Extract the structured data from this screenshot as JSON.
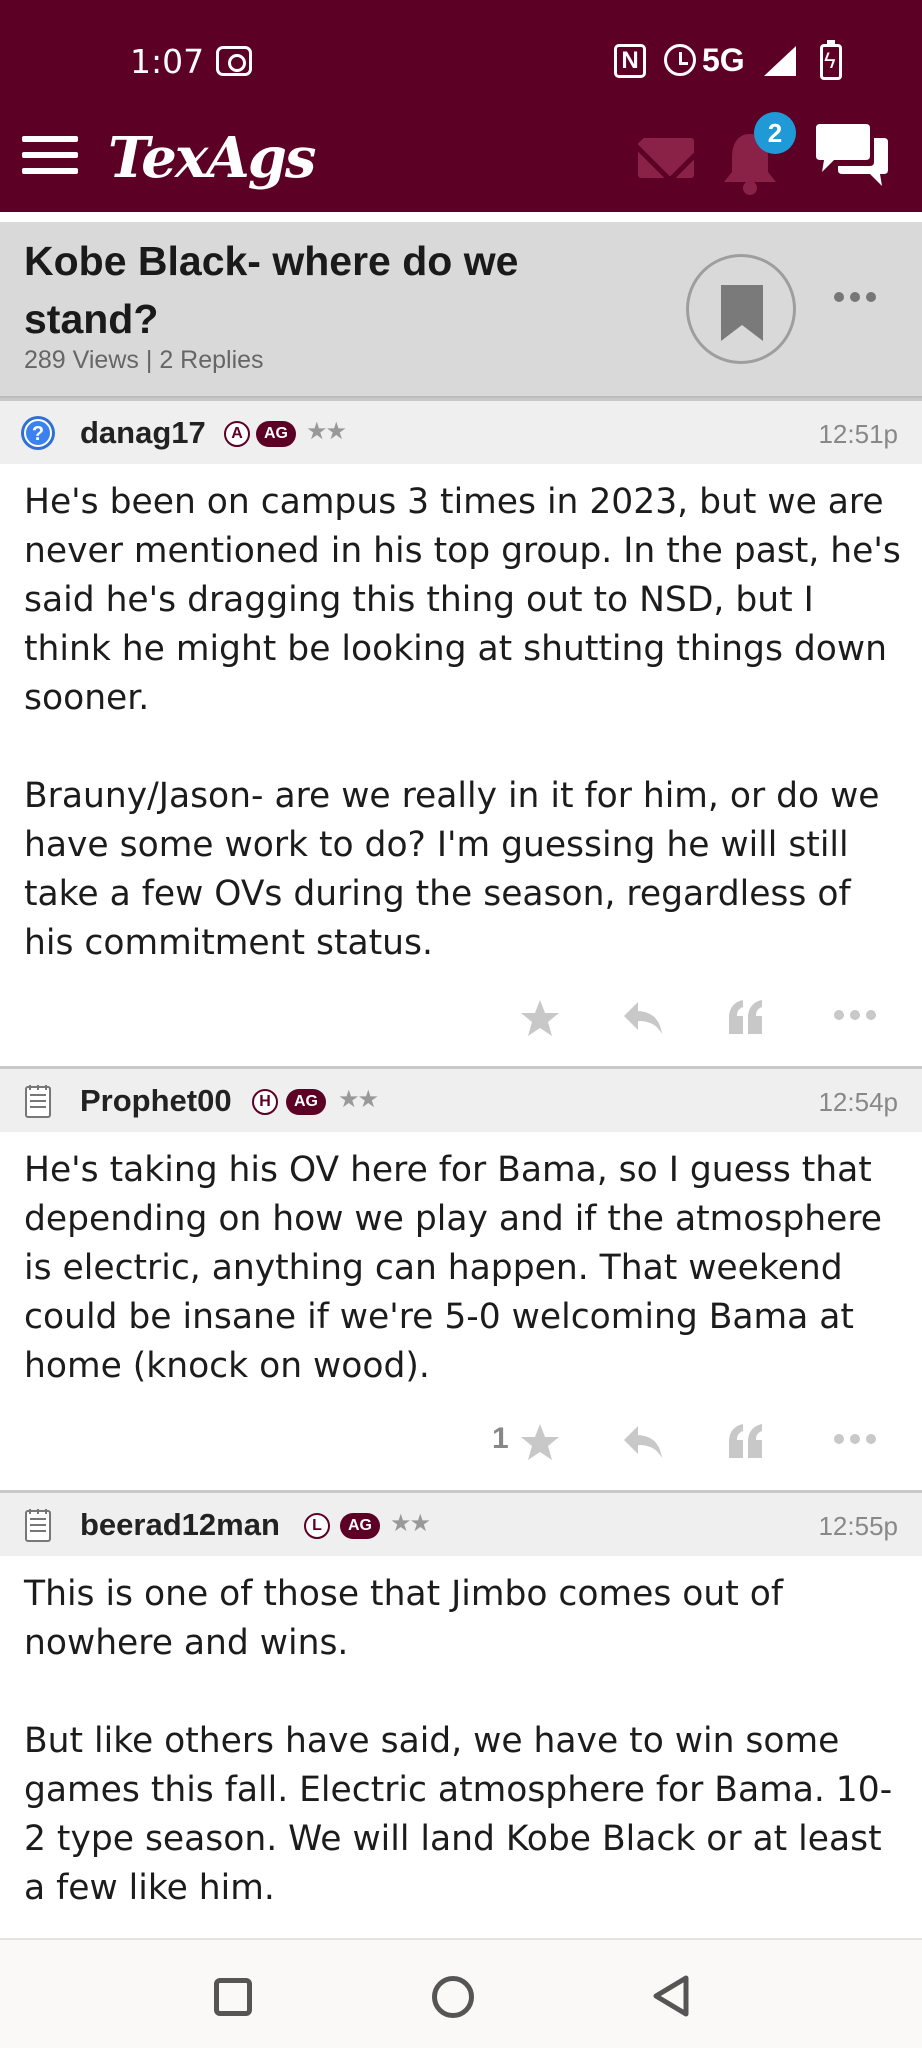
{
  "status_bar": {
    "time": "1:07",
    "network": "5G"
  },
  "app_bar": {
    "logo": "TexAgs",
    "notification_count": "2"
  },
  "thread": {
    "title": "Kobe Black- where do we stand?",
    "views": "289 Views",
    "separator": "|",
    "replies": "2 Replies"
  },
  "posts": [
    {
      "username": "danag17",
      "badge_letter": "A",
      "badge_ag": "AG",
      "stars": "★★",
      "time": "12:51p",
      "body": "He's been on campus 3 times in 2023, but we are never mentioned in his top group. In the past, he's said he's dragging this thing out to NSD, but I think he might be looking at shutting things down sooner.\n\nBrauny/Jason- are we really in it for him, or do we have some work to do? I'm guessing he will still take a few OVs during the season, regardless of his commitment status.",
      "star_count": ""
    },
    {
      "username": "Prophet00",
      "badge_letter": "H",
      "badge_ag": "AG",
      "stars": "★★",
      "time": "12:54p",
      "body": "He's taking his OV here for Bama, so I guess that depending on how we play and if the atmosphere is electric, anything can happen. That weekend could be insane if we're 5-0 welcoming Bama at home (knock on wood).",
      "star_count": "1"
    },
    {
      "username": "beerad12man",
      "badge_letter": "L",
      "badge_ag": "AG",
      "stars": "★★",
      "time": "12:55p",
      "body": "This is one of those that Jimbo comes out of nowhere and wins.\n\nBut like others have said, we have to win some games this fall. Electric atmosphere for Bama. 10-2 type season. We will land Kobe Black or at least a few like him.",
      "star_count": ""
    }
  ],
  "colors": {
    "brand": "#5c0025",
    "badge_blue": "#1f9ad6",
    "icon_gray": "#c8c8c8"
  },
  "icons": [
    "menu-icon",
    "mail-icon",
    "bell-icon",
    "chat-icon",
    "bookmark-icon",
    "more-icon",
    "star-icon",
    "reply-icon",
    "quote-icon",
    "question-icon",
    "notepad-icon"
  ]
}
